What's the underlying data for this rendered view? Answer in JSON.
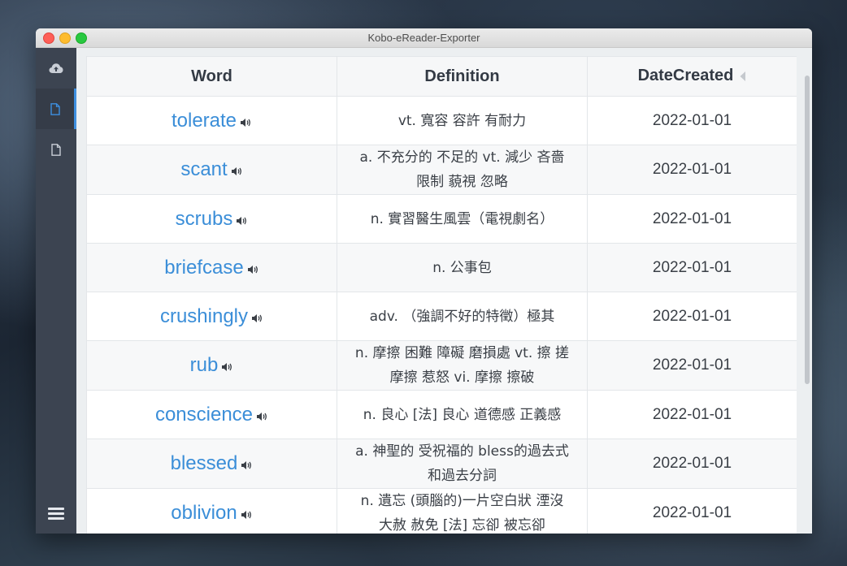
{
  "window": {
    "title": "Kobo-eReader-Exporter"
  },
  "sidebar": {
    "items": [
      {
        "icon": "cloud-upload-icon"
      },
      {
        "icon": "document-icon",
        "active": true
      },
      {
        "icon": "document-icon"
      }
    ],
    "menu_icon": "hamburger-menu-icon"
  },
  "table": {
    "headers": {
      "word": "Word",
      "definition": "Definition",
      "date": "DateCreated"
    },
    "sort": {
      "column": "DateCreated"
    },
    "rows": [
      {
        "word": "tolerate",
        "definition": "vt. 寬容 容許 有耐力",
        "date": "2022-01-01"
      },
      {
        "word": "scant",
        "definition": "a. 不充分的 不足的 vt. 減少 吝嗇 限制 藐視 忽略",
        "date": "2022-01-01"
      },
      {
        "word": "scrubs",
        "definition": "n. 實習醫生風雲（電視劇名）",
        "date": "2022-01-01"
      },
      {
        "word": "briefcase",
        "definition": "n. 公事包",
        "date": "2022-01-01"
      },
      {
        "word": "crushingly",
        "definition": "adv. （強調不好的特徵）極其",
        "date": "2022-01-01"
      },
      {
        "word": "rub",
        "definition": "n. 摩擦 困難 障礙 磨損處 vt. 擦 搓 摩擦 惹怒 vi. 摩擦 擦破",
        "date": "2022-01-01"
      },
      {
        "word": "conscience",
        "definition": "n. 良心 [法] 良心 道德感 正義感",
        "date": "2022-01-01"
      },
      {
        "word": "blessed",
        "definition": "a. 神聖的 受祝福的 bless的過去式和過去分詞",
        "date": "2022-01-01"
      },
      {
        "word": "oblivion",
        "definition": "n. 遺忘 (頭腦的)一片空白狀 湮沒 大赦 赦免 [法] 忘卻 被忘卻",
        "date": "2022-01-01"
      }
    ]
  },
  "colors": {
    "accent": "#3d8fe0",
    "word_link": "#3b8ed8",
    "sidebar_bg": "#3c4451"
  }
}
